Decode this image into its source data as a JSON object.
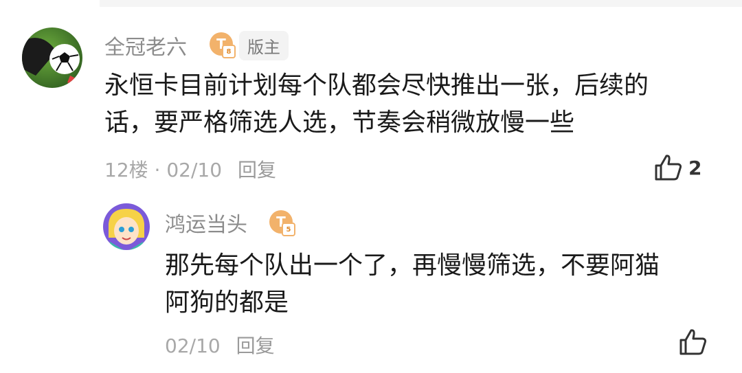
{
  "comments": [
    {
      "username": "全冠老六",
      "level_letter": "T",
      "level_num": "8",
      "role_tag": "版主",
      "content_line1": "永恒卡目前计划每个队都会尽快推出一张，后续的",
      "content_line2": "话，要严格筛选人选，节奏会稍微放慢一些",
      "floor": "12楼",
      "sep": "·",
      "date": "02/10",
      "reply_label": "回复",
      "like_count": "2"
    }
  ],
  "replies": [
    {
      "username": "鸿运当头",
      "level_letter": "T",
      "level_num": "5",
      "content_line1": "那先每个队出一个了，再慢慢筛选，不要阿猫",
      "content_line2": "阿狗的都是",
      "date": "02/10",
      "reply_label": "回复",
      "like_count": ""
    }
  ],
  "icons": {
    "like": "thumbs-up-icon",
    "avatar_1": "soccer-avatar-icon",
    "avatar_2": "cartoon-avatar-icon"
  },
  "colors": {
    "level_badge": "#f2b26b",
    "name_gray": "#8c8c8c",
    "meta_gray": "#a8a8a8"
  }
}
